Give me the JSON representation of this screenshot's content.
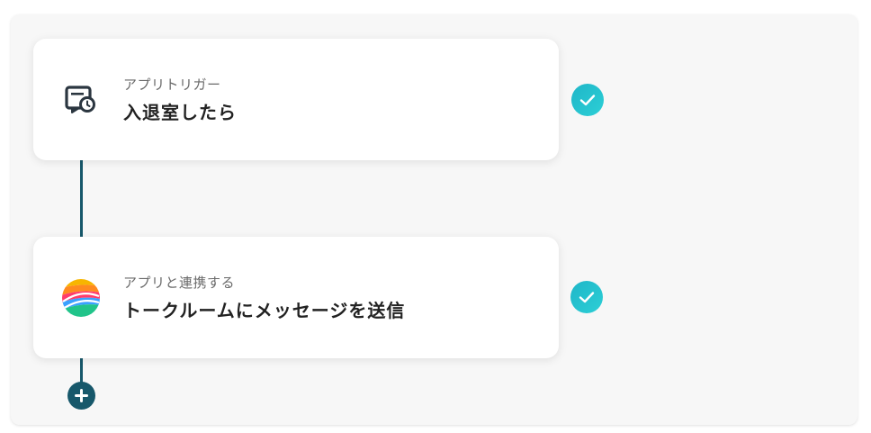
{
  "flow": {
    "steps": [
      {
        "sublabel": "アプリトリガー",
        "title": "入退室したら",
        "icon": "entry-exit-trigger-icon",
        "status": "completed"
      },
      {
        "sublabel": "アプリと連携する",
        "title": "トークルームにメッセージを送信",
        "icon": "chat-app-logo-icon",
        "status": "completed"
      }
    ],
    "add_step_icon": "plus-icon"
  },
  "colors": {
    "connector": "#17586b",
    "check_badge": "#1fb6c8",
    "panel_bg": "#f7f7f7",
    "card_bg": "#ffffff"
  }
}
